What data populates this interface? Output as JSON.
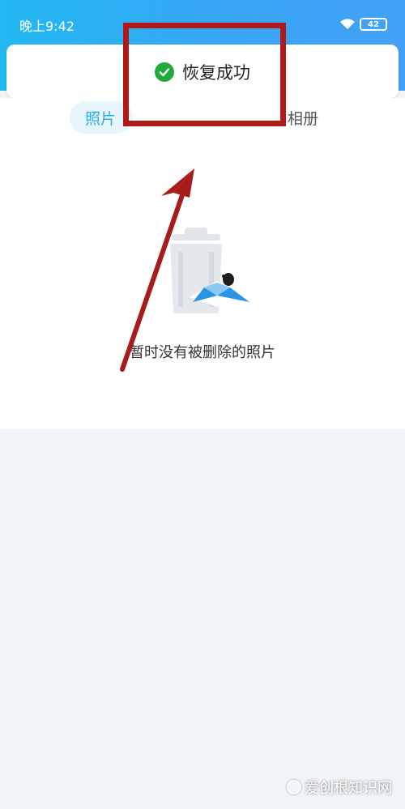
{
  "status_bar": {
    "time": "晚上9:42",
    "battery": "42"
  },
  "toast": {
    "message": "恢复成功"
  },
  "tabs": [
    {
      "label": "照片",
      "active": true
    },
    {
      "label": "相册",
      "active": false
    }
  ],
  "empty_state": {
    "message": "暂时没有被删除的照片"
  },
  "watermark": {
    "text": "爱创根知识网"
  },
  "colors": {
    "header_gradient_start": "#22b8f2",
    "header_gradient_end": "#43a1f8",
    "accent": "#27aee6",
    "success": "#1faa3a",
    "annotation_red": "#b11919"
  }
}
